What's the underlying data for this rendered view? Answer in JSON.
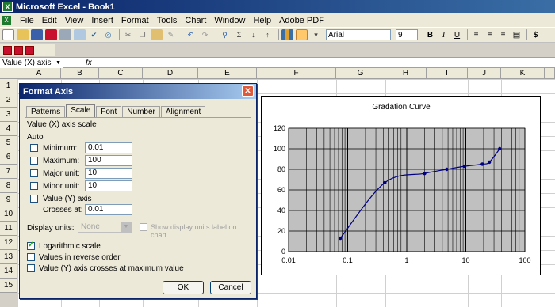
{
  "app": {
    "title": "Microsoft Excel - Book1"
  },
  "menu": {
    "items": [
      "File",
      "Edit",
      "View",
      "Insert",
      "Format",
      "Tools",
      "Chart",
      "Window",
      "Help",
      "Adobe PDF"
    ]
  },
  "toolbar": {
    "font_name": "Arial",
    "font_size": "9",
    "bold": "B",
    "italic": "I",
    "underline": "U",
    "currency": "$"
  },
  "formula_bar": {
    "name_box": "Value (X) axis",
    "fx": "fx",
    "formula": ""
  },
  "columns": [
    "A",
    "B",
    "C",
    "D",
    "E",
    "F",
    "G",
    "H",
    "I",
    "J",
    "K"
  ],
  "rows": [
    "1",
    "2",
    "3",
    "4",
    "5",
    "6",
    "7",
    "8",
    "9",
    "10",
    "11",
    "12",
    "13",
    "14",
    "15"
  ],
  "dialog": {
    "title": "Format Axis",
    "close": "✕",
    "tabs": [
      "Patterns",
      "Scale",
      "Font",
      "Number",
      "Alignment"
    ],
    "active_tab": "Scale",
    "scale_heading": "Value (X) axis scale",
    "auto_label": "Auto",
    "fields": [
      {
        "label": "Minimum:",
        "value": "0.01",
        "checked": false
      },
      {
        "label": "Maximum:",
        "value": "100",
        "checked": false
      },
      {
        "label": "Major unit:",
        "value": "10",
        "checked": false
      },
      {
        "label": "Minor unit:",
        "value": "10",
        "checked": false
      }
    ],
    "value_axis_label": "Value (Y) axis",
    "crosses_at_label": "Crosses at:",
    "crosses_at_value": "0.01",
    "display_units_label": "Display units:",
    "display_units_value": "None",
    "show_units_label": "Show display units label on chart",
    "log_scale_label": "Logarithmic scale",
    "log_scale_checked": true,
    "reverse_label": "Values in reverse order",
    "reverse_checked": false,
    "crosses_max_label": "Value (Y) axis crosses at maximum value",
    "crosses_max_checked": false,
    "ok": "OK",
    "cancel": "Cancel"
  },
  "chart_data": {
    "type": "scatter",
    "title": "Gradation Curve",
    "xlabel": "",
    "ylabel": "",
    "x_scale": "log",
    "xlim": [
      0.01,
      100
    ],
    "ylim": [
      0,
      120
    ],
    "x_ticks": [
      "0.01",
      "0.1",
      "1",
      "10",
      "100"
    ],
    "y_ticks": [
      "0",
      "20",
      "40",
      "60",
      "80",
      "100",
      "120"
    ],
    "grid": true,
    "plot_bg": "#c0c0c0",
    "series": [
      {
        "color": "#000080",
        "x": [
          0.075,
          0.425,
          2,
          4.75,
          9.5,
          19,
          25,
          37.5
        ],
        "y": [
          13,
          67,
          76,
          80,
          83,
          85,
          87,
          100
        ]
      }
    ]
  }
}
